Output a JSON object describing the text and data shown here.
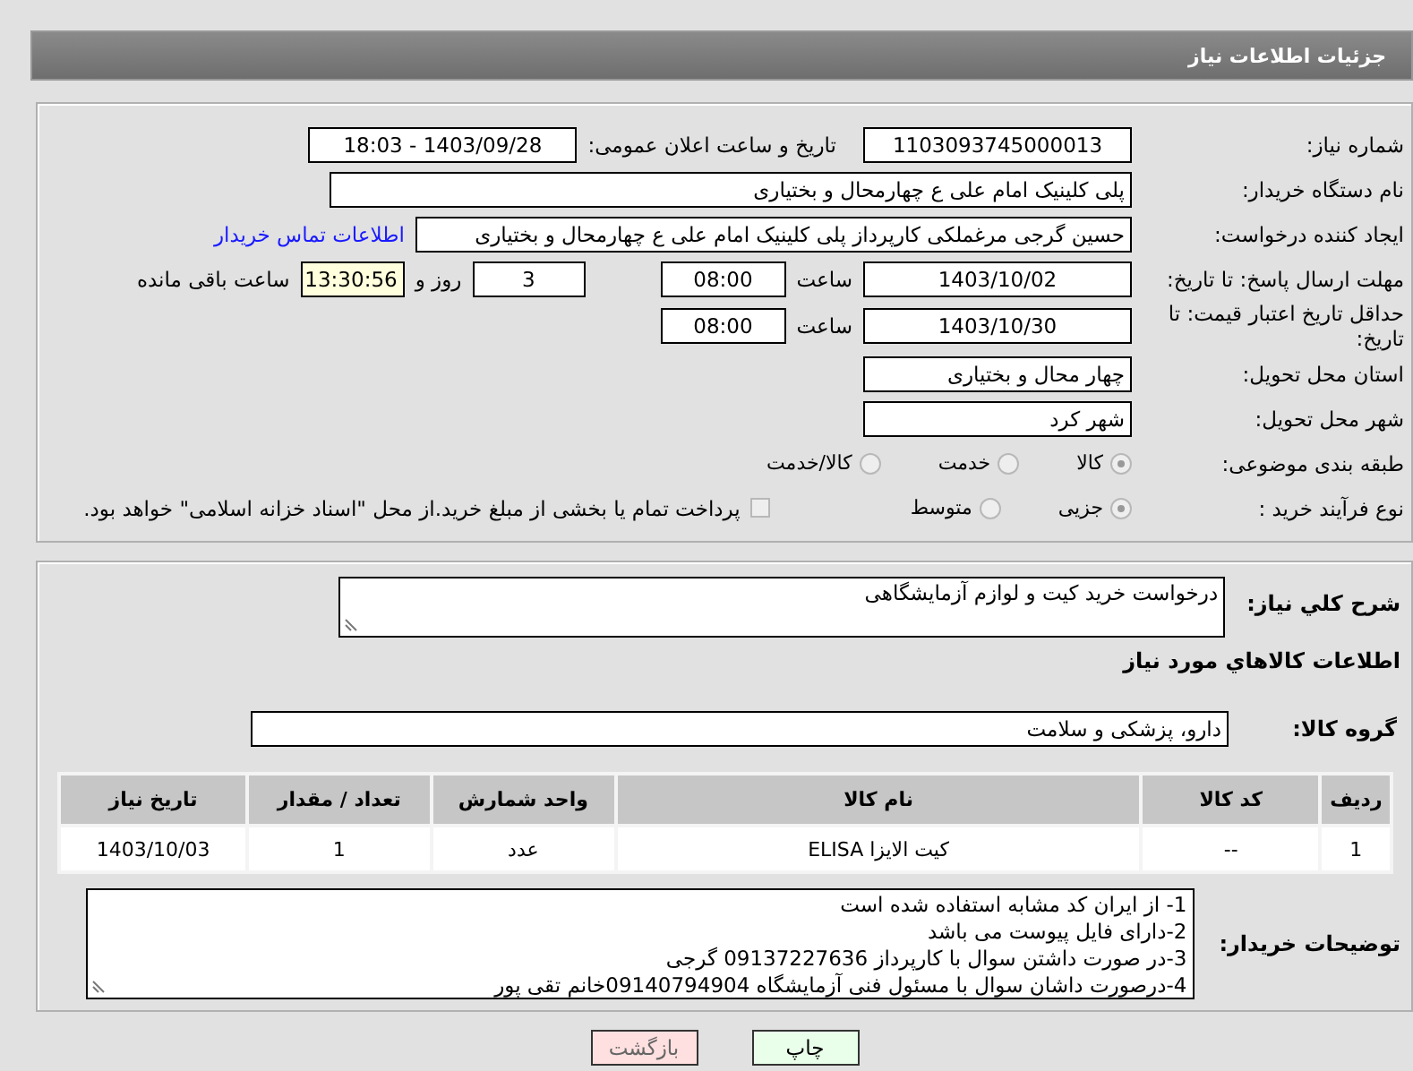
{
  "header": {
    "title": "جزئیات اطلاعات نیاز"
  },
  "details": {
    "need_number": {
      "label": "شماره نیاز:",
      "value": "1103093745000013"
    },
    "announce_datetime": {
      "label": "تاریخ و ساعت اعلان عمومی:",
      "value": "1403/09/28 - 18:03"
    },
    "buyer_org": {
      "label": "نام دستگاه خریدار:",
      "value": "پلی کلینیک امام علی  ع  چهارمحال و بختیاری"
    },
    "requester": {
      "label": "ایجاد کننده درخواست:",
      "value": "حسین گرجی مرغملکی کارپرداز پلی کلینیک امام علی  ع  چهارمحال و بختیاری",
      "link": "اطلاعات تماس خریدار"
    },
    "reply_deadline": {
      "label": "مهلت ارسال پاسخ: تا تاریخ:",
      "date": "1403/10/02",
      "time_label": "ساعت",
      "time": "08:00",
      "days": "3",
      "days_label": "روز و",
      "remaining": "13:30:56",
      "remaining_label": "ساعت باقی مانده"
    },
    "price_validity": {
      "label": "حداقل تاریخ اعتبار قیمت: تا تاریخ:",
      "date": "1403/10/30",
      "time_label": "ساعت",
      "time": "08:00"
    },
    "province": {
      "label": "استان محل تحویل:",
      "value": "چهار محال و بختیاری"
    },
    "city": {
      "label": "شهر محل تحویل:",
      "value": "شهر کرد"
    },
    "category": {
      "label": "طبقه بندی موضوعی:",
      "options": [
        {
          "label": "کالا",
          "selected": true
        },
        {
          "label": "خدمت",
          "selected": false
        },
        {
          "label": "کالا/خدمت",
          "selected": false
        }
      ]
    },
    "process": {
      "label": "نوع فرآیند خرید :",
      "options": [
        {
          "label": "جزیی",
          "selected": true
        },
        {
          "label": "متوسط",
          "selected": false
        }
      ],
      "payment": {
        "label": "پرداخت تمام یا بخشی از مبلغ خرید.از محل \"اسناد خزانه اسلامی\" خواهد بود.",
        "checked": false
      }
    }
  },
  "description": {
    "label": "شرح کلي نياز:",
    "value": "درخواست خرید کیت و لوازم آزمایشگاهی"
  },
  "goods": {
    "title": "اطلاعات کالاهاي مورد نياز",
    "group_label": "گروه کالا:",
    "group": "دارو، پزشکی و سلامت",
    "table": {
      "columns": [
        "ردیف",
        "کد کالا",
        "نام کالا",
        "واحد شمارش",
        "تعداد / مقدار",
        "تاریخ نیاز"
      ],
      "rows": [
        [
          "1",
          "--",
          "کیت الایزا ELISA",
          "عدد",
          "1",
          "1403/10/03"
        ]
      ]
    }
  },
  "buyer_notes": {
    "label": "توضیحات خریدار:",
    "lines": [
      "1- از ایران کد مشابه استفاده شده است",
      "2-دارای فایل پیوست می باشد",
      "3-در صورت داشتن سوال با کارپرداز 09137227636 گرجی",
      "4-درصورت داشان سوال با مسئول فنی آزمایشگاه 09140794904خانم تقی پور"
    ]
  },
  "buttons": [
    {
      "label": "چاپ",
      "kind": "print"
    },
    {
      "label": "بازگشت",
      "kind": "back"
    }
  ]
}
